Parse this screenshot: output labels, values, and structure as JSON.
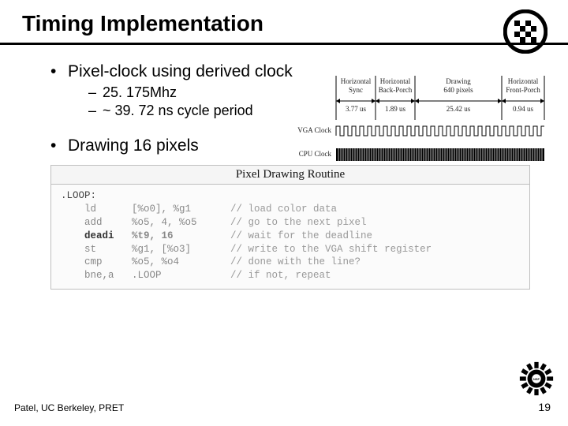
{
  "title": "Timing Implementation",
  "bullets": [
    {
      "text": "Pixel-clock using derived clock",
      "subs": [
        "25. 175Mhz",
        "~ 39. 72 ns cycle period"
      ]
    },
    {
      "text": "Drawing 16 pixels",
      "subs": []
    }
  ],
  "timing_diagram": {
    "segments": [
      {
        "top": "Horizontal",
        "bottom": "Sync",
        "time": "3.77 us"
      },
      {
        "top": "Horizontal",
        "bottom": "Back-Porch",
        "time": "1.89 us"
      },
      {
        "top": "Drawing",
        "bottom": "640 pixels",
        "time": "25.42 us"
      },
      {
        "top": "Horizontal",
        "bottom": "Front-Porch",
        "time": "0.94 us"
      }
    ],
    "row_labels": [
      "VGA Clock",
      "CPU Clock"
    ]
  },
  "code_box": {
    "title": "Pixel Drawing Routine",
    "lines": [
      {
        "label": ".LOOP:",
        "op": "",
        "args": "",
        "comment": ""
      },
      {
        "label": "",
        "op": "ld",
        "args": "[%o0], %g1",
        "comment": "// load color data"
      },
      {
        "label": "",
        "op": "add",
        "args": "%o5, 4, %o5",
        "comment": "// go to the next pixel"
      },
      {
        "label": "",
        "op": "deadi",
        "args": "%t9, 16",
        "comment": "// wait for the deadline",
        "bold": true
      },
      {
        "label": "",
        "op": "st",
        "args": "%g1, [%o3]",
        "comment": "// write to the VGA shift register"
      },
      {
        "label": "",
        "op": "cmp",
        "args": "%o5, %o4",
        "comment": "// done with the line?"
      },
      {
        "label": "",
        "op": "bne,a",
        "args": ".LOOP",
        "comment": "// if not, repeat"
      }
    ]
  },
  "footer": {
    "left": "Patel, UC Berkeley, PRET",
    "page": "19"
  },
  "chart_data": {
    "type": "table",
    "title": "Horizontal line timing segments",
    "categories": [
      "Horizontal Sync",
      "Horizontal Back-Porch",
      "Drawing 640 pixels",
      "Horizontal Front-Porch"
    ],
    "values_us": [
      3.77,
      1.89,
      25.42,
      0.94
    ],
    "clock_rows": [
      "VGA Clock",
      "CPU Clock"
    ]
  }
}
